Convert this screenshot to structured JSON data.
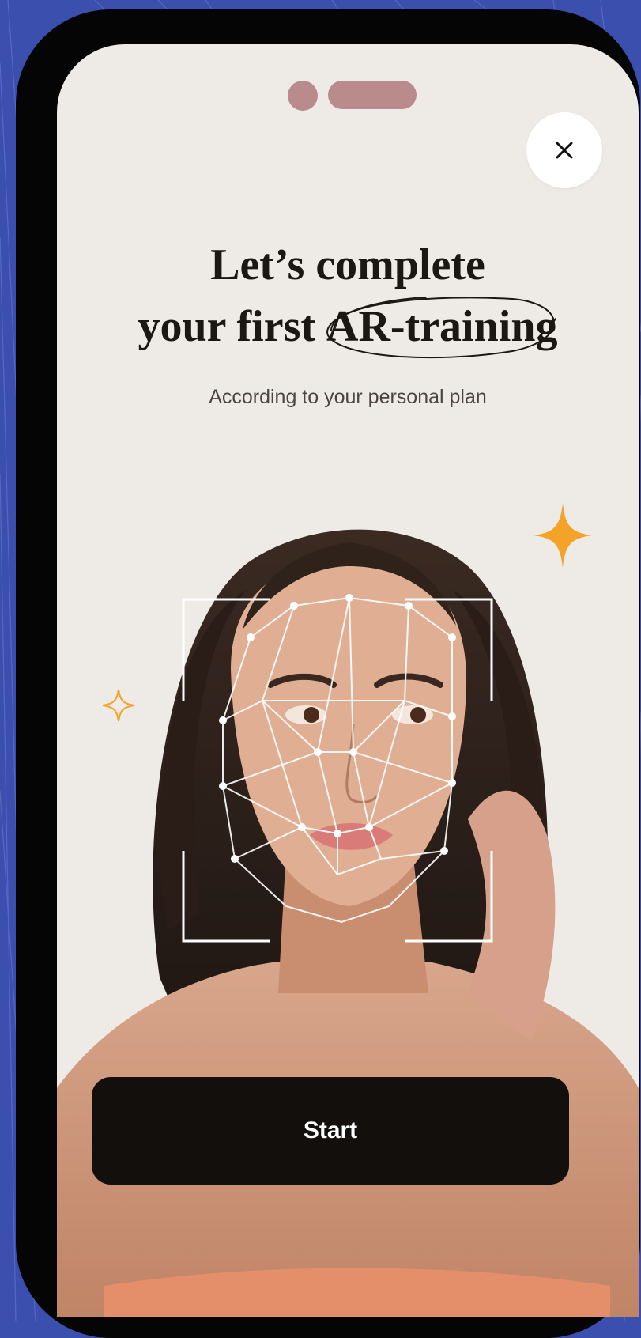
{
  "screen": {
    "title_line1": "Let’s complete",
    "title_line2_prefix": "your first ",
    "title_line2_highlight": "AR-training",
    "subtitle": "According to your personal plan",
    "close_icon": "close-icon",
    "start_label": "Start"
  },
  "colors": {
    "background": "#3a4fae",
    "screen": "#eeebe7",
    "accent_star": "#f4a228",
    "button": "#120f0d"
  }
}
